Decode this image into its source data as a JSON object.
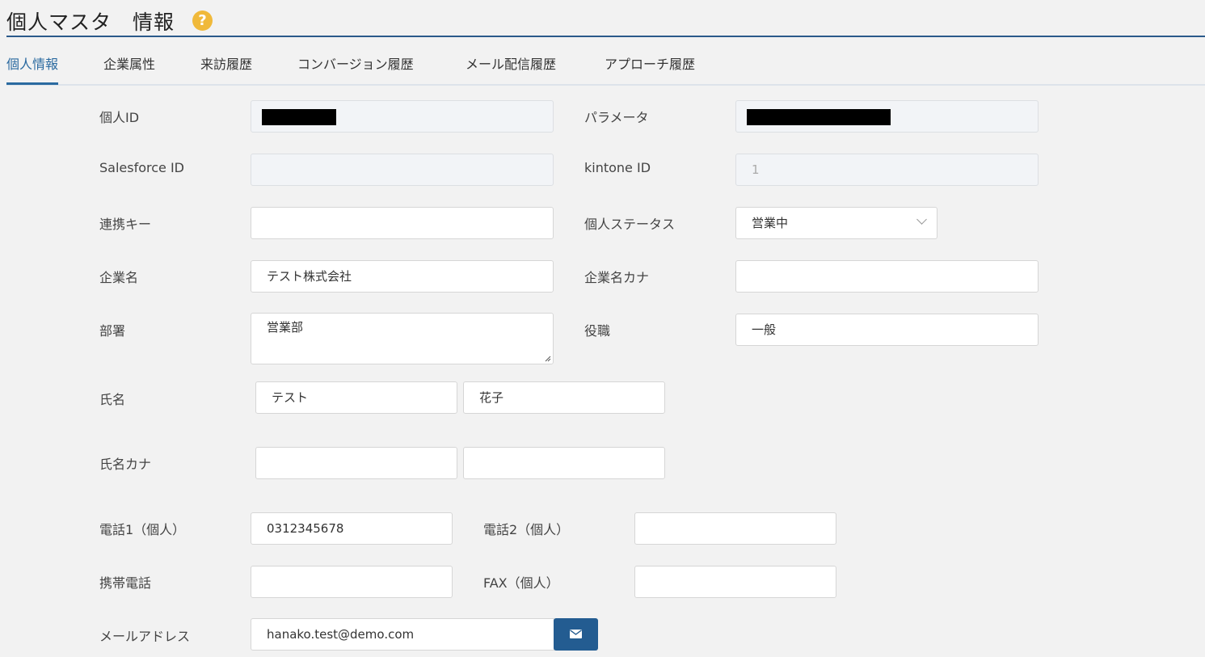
{
  "header": {
    "title": "個人マスタ　情報",
    "help_icon": "question-circle-icon",
    "help_glyph": "?"
  },
  "tabs": [
    {
      "label": "個人情報",
      "active": true
    },
    {
      "label": "企業属性",
      "active": false
    },
    {
      "label": "来訪履歴",
      "active": false
    },
    {
      "label": "コンバージョン履歴",
      "active": false
    },
    {
      "label": "メール配信履歴",
      "active": false
    },
    {
      "label": "アプローチ履歴",
      "active": false
    }
  ],
  "form": {
    "person_id": {
      "label": "個人ID",
      "value": ""
    },
    "parameter": {
      "label": "パラメータ",
      "value": ""
    },
    "salesforce_id": {
      "label": "Salesforce ID",
      "value": ""
    },
    "kintone_id": {
      "label": "kintone ID",
      "value": "1"
    },
    "link_key": {
      "label": "連携キー",
      "value": ""
    },
    "person_status": {
      "label": "個人ステータス",
      "value": "営業中"
    },
    "company_name": {
      "label": "企業名",
      "value": "テスト株式会社"
    },
    "company_name_kana": {
      "label": "企業名カナ",
      "value": ""
    },
    "department": {
      "label": "部署",
      "value": "営業部"
    },
    "position": {
      "label": "役職",
      "value": "一般"
    },
    "name": {
      "label": "氏名",
      "last": "テスト",
      "first": "花子"
    },
    "name_kana": {
      "label": "氏名カナ",
      "last": "",
      "first": ""
    },
    "phone1": {
      "label": "電話1（個人）",
      "value": "0312345678"
    },
    "phone2": {
      "label": "電話2（個人）",
      "value": ""
    },
    "mobile": {
      "label": "携帯電話",
      "value": ""
    },
    "fax": {
      "label": "FAX（個人）",
      "value": ""
    },
    "email": {
      "label": "メールアドレス",
      "value": "hanako.test@demo.com"
    }
  },
  "colors": {
    "accent": "#2b6aa0",
    "button": "#235c91",
    "help": "#f0b93a"
  }
}
